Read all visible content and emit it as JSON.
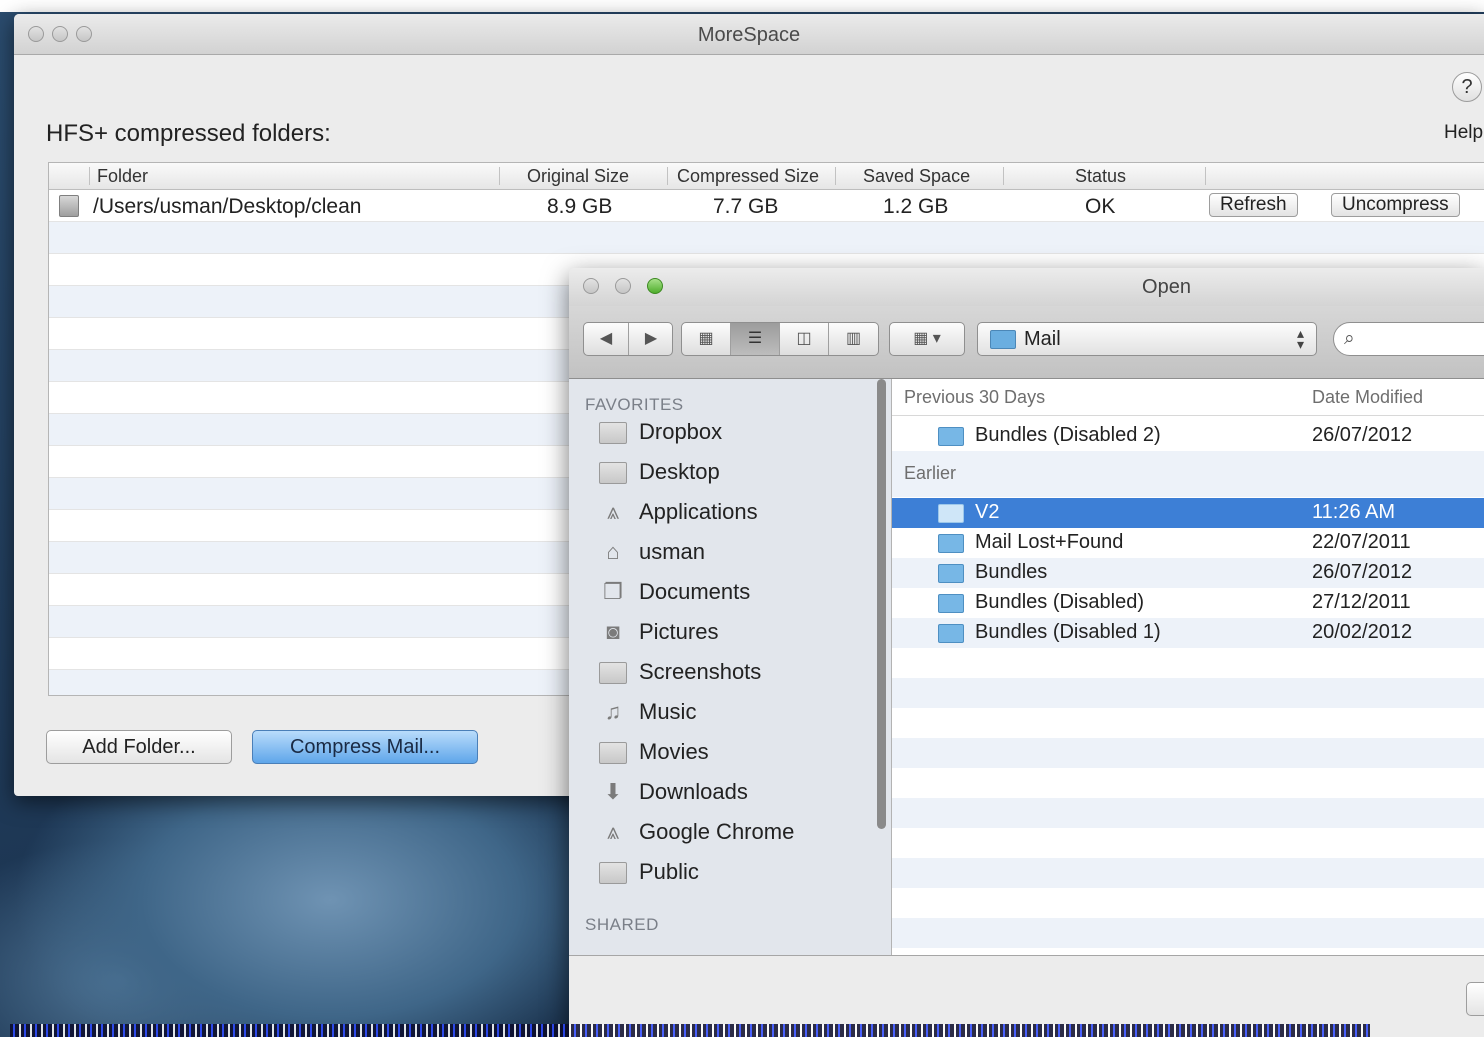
{
  "main_window": {
    "title": "MoreSpace",
    "help_glyph": "?",
    "help_label": "Help",
    "section_title": "HFS+ compressed folders:",
    "columns": [
      "Folder",
      "Original Size",
      "Compressed Size",
      "Saved Space",
      "Status"
    ],
    "rows": [
      {
        "folder": "/Users/usman/Desktop/clean",
        "original": "8.9 GB",
        "compressed": "7.7 GB",
        "saved": "1.2 GB",
        "status": "OK",
        "refresh": "Refresh",
        "uncompress": "Uncompress"
      }
    ],
    "add_folder": "Add Folder...",
    "compress_mail": "Compress Mail..."
  },
  "open_dialog": {
    "title": "Open",
    "path": "Mail",
    "sidebar": {
      "favorites_header": "FAVORITES",
      "items": [
        {
          "label": "Dropbox",
          "icon": "folder-icon"
        },
        {
          "label": "Desktop",
          "icon": "desktop-icon"
        },
        {
          "label": "Applications",
          "icon": "applications-icon"
        },
        {
          "label": "usman",
          "icon": "home-icon"
        },
        {
          "label": "Documents",
          "icon": "documents-icon"
        },
        {
          "label": "Pictures",
          "icon": "camera-icon"
        },
        {
          "label": "Screenshots",
          "icon": "folder-icon"
        },
        {
          "label": "Music",
          "icon": "music-note-icon"
        },
        {
          "label": "Movies",
          "icon": "film-icon"
        },
        {
          "label": "Downloads",
          "icon": "download-icon"
        },
        {
          "label": "Google Chrome",
          "icon": "applications-icon"
        },
        {
          "label": "Public",
          "icon": "folder-icon"
        }
      ],
      "shared_header": "SHARED"
    },
    "list_header": {
      "name": "Previous 30 Days",
      "date": "Date Modified"
    },
    "group_recent": [
      {
        "name": "Bundles (Disabled 2)",
        "date": "26/07/2012"
      }
    ],
    "group_earlier_label": "Earlier",
    "group_earlier": [
      {
        "name": "V2",
        "date": "11:26 AM",
        "selected": true
      },
      {
        "name": "Mail Lost+Found",
        "date": "22/07/2011"
      },
      {
        "name": "Bundles",
        "date": "26/07/2012"
      },
      {
        "name": "Bundles (Disabled)",
        "date": "27/12/2011"
      },
      {
        "name": "Bundles (Disabled 1)",
        "date": "20/02/2012"
      }
    ]
  },
  "colors": {
    "selection": "#3d7fd6",
    "primary_button": "#5fa6ea",
    "folder_blue": "#77b7e6"
  }
}
